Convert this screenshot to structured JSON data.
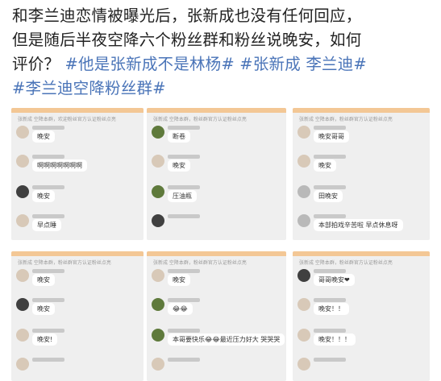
{
  "post": {
    "line1": "和李兰迪恋情被曝光后，张新成也没有任何回应，",
    "line2": "但是随后半夜空降六个粉丝群和粉丝说晚安，如何",
    "line3_prefix": "评价？ ",
    "tags": [
      "#他是张新成不是林杨#",
      "#张新成 李兰迪#",
      "#李兰迪空降粉丝群#"
    ]
  },
  "colors": {
    "tag": "#4a74b8",
    "chat_bg": "#efefef",
    "bubble": "#ffffff"
  },
  "screens": [
    {
      "header": "张新成 空降本群，欢迎粉丝官方认证粉丝点亮",
      "messages": [
        {
          "text": "晚安",
          "avatar": "avatar"
        },
        {
          "text": "啊啊啊啊啊啊啊",
          "avatar": "avatar"
        },
        {
          "text": "晚安",
          "avatar": "avatar-dark"
        },
        {
          "text": "早点睡",
          "avatar": "avatar"
        }
      ]
    },
    {
      "header": "张新成 空降本群，粉丝群官方认证粉丝点亮",
      "messages": [
        {
          "text": "断卷",
          "avatar": "avatar-green"
        },
        {
          "text": "晚安",
          "avatar": "avatar"
        },
        {
          "text": "压油瓶",
          "avatar": "avatar-green"
        },
        {
          "text": "",
          "avatar": "avatar-dark"
        }
      ]
    },
    {
      "header": "张新成 空降本群，粉丝群官方认证粉丝点亮",
      "messages": [
        {
          "text": "晚安哥哥",
          "avatar": "avatar"
        },
        {
          "text": "晚安",
          "avatar": "avatar"
        },
        {
          "text": "田晚安",
          "avatar": "avatar-gray"
        },
        {
          "text": "本部拍戏辛苦啦 早点休息呀",
          "avatar": "avatar-gray"
        }
      ]
    },
    {
      "header": "张新成 空降本群，粉丝群官方认证粉丝点亮",
      "messages": [
        {
          "text": "晚安",
          "avatar": "avatar"
        },
        {
          "text": "晚安",
          "avatar": "avatar-dark"
        },
        {
          "text": "晚安!",
          "avatar": "avatar"
        },
        {
          "text": "",
          "avatar": "avatar"
        }
      ]
    },
    {
      "header": "张新成 空降本群，粉丝群官方认证粉丝点亮",
      "messages": [
        {
          "text": "晚安",
          "avatar": "avatar"
        },
        {
          "text": "😂😂",
          "avatar": "avatar-green"
        },
        {
          "text": "本哥要快乐😂😂最近压力好大 哭哭哭",
          "avatar": "avatar-green"
        },
        {
          "text": "",
          "avatar": "avatar"
        }
      ]
    },
    {
      "header": "张新成 空降本群，粉丝群官方认证粉丝点亮",
      "messages": [
        {
          "text": "哥哥晚安❤",
          "avatar": "avatar-dark"
        },
        {
          "text": "晚安！！",
          "avatar": "avatar"
        },
        {
          "text": "晚安！！！",
          "avatar": "avatar"
        },
        {
          "text": "",
          "avatar": "avatar"
        }
      ]
    }
  ]
}
